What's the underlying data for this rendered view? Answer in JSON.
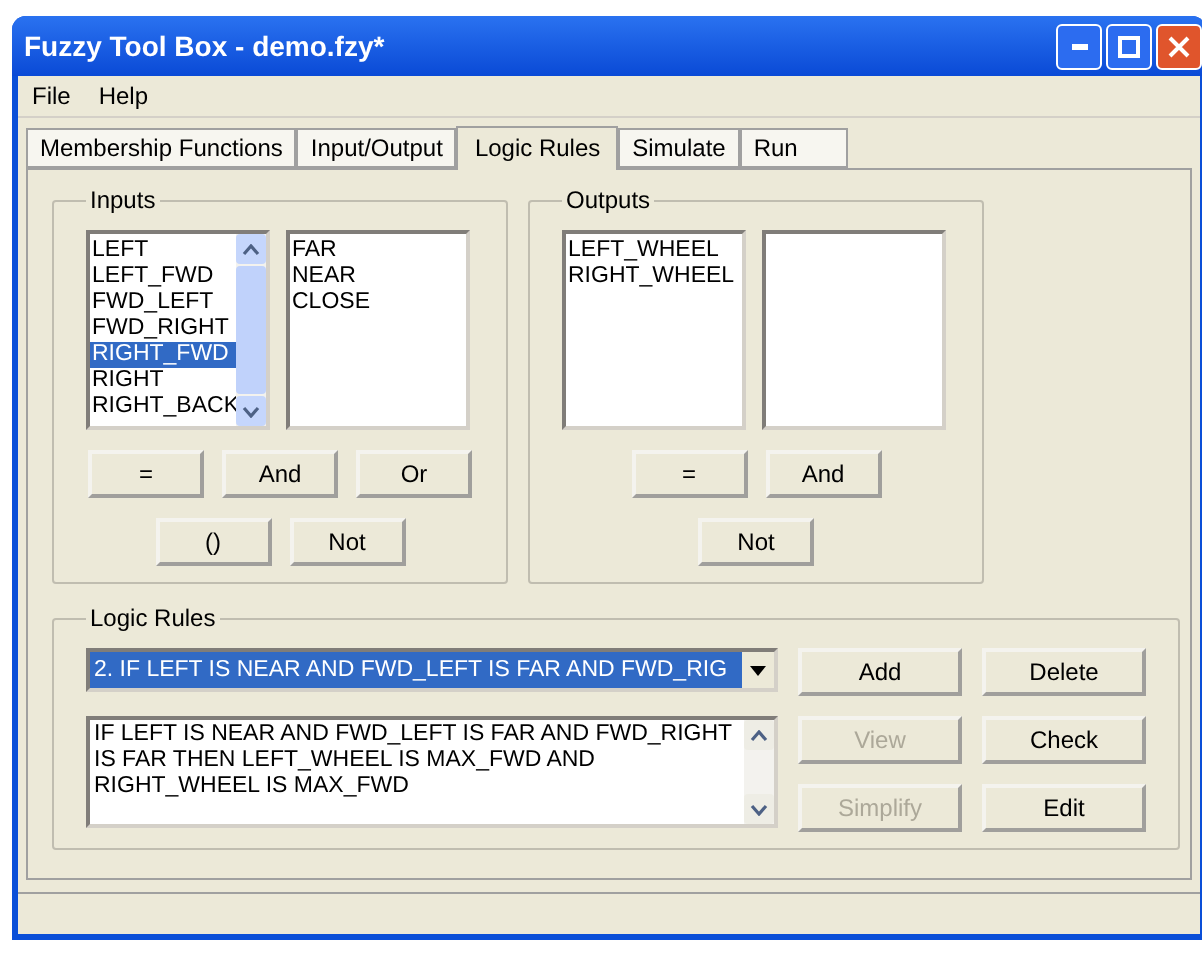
{
  "window": {
    "title": "Fuzzy Tool Box - demo.fzy*"
  },
  "menu": [
    "File",
    "Help"
  ],
  "tabs": [
    {
      "label": "Membership Functions",
      "selected": false
    },
    {
      "label": "Input/Output",
      "selected": false
    },
    {
      "label": "Logic Rules",
      "selected": true
    },
    {
      "label": "Simulate",
      "selected": false
    },
    {
      "label": "Run",
      "selected": false
    }
  ],
  "inputs": {
    "title": "Inputs",
    "variables": [
      {
        "label": "LEFT",
        "selected": false
      },
      {
        "label": "LEFT_FWD",
        "selected": false
      },
      {
        "label": "FWD_LEFT",
        "selected": false
      },
      {
        "label": "FWD_RIGHT",
        "selected": false
      },
      {
        "label": "RIGHT_FWD",
        "selected": true
      },
      {
        "label": "RIGHT",
        "selected": false
      },
      {
        "label": "RIGHT_BACK",
        "selected": false
      }
    ],
    "terms": [
      "FAR",
      "NEAR",
      "CLOSE"
    ],
    "button_rows": [
      [
        "=",
        "And",
        "Or"
      ],
      [
        "()",
        "Not"
      ]
    ]
  },
  "outputs": {
    "title": "Outputs",
    "variables": [
      {
        "label": "LEFT_WHEEL",
        "selected": false
      },
      {
        "label": "RIGHT_WHEEL",
        "selected": false
      }
    ],
    "button_rows": [
      [
        "=",
        "And"
      ],
      [
        "Not"
      ]
    ]
  },
  "logic_rules": {
    "title": "Logic Rules",
    "rule_select": "2. IF LEFT IS NEAR   AND FWD_LEFT IS FAR AND FWD_RIG",
    "rule_text": "IF LEFT IS NEAR   AND FWD_LEFT IS FAR AND FWD_RIGHT IS FAR THEN LEFT_WHEEL IS MAX_FWD AND RIGHT_WHEEL IS MAX_FWD",
    "buttons": [
      {
        "label": "Add",
        "disabled": false
      },
      {
        "label": "Delete",
        "disabled": false
      },
      {
        "label": "View",
        "disabled": true
      },
      {
        "label": "Check",
        "disabled": false
      },
      {
        "label": "Simplify",
        "disabled": true
      },
      {
        "label": "Edit",
        "disabled": false
      }
    ]
  }
}
